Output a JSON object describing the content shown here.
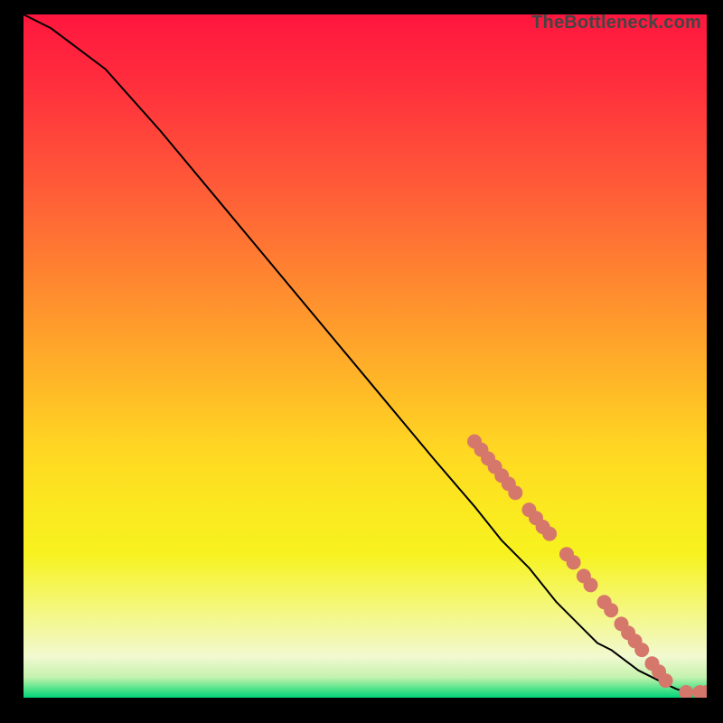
{
  "watermark": "TheBottleneck.com",
  "chart_data": {
    "type": "line",
    "title": "",
    "xlabel": "",
    "ylabel": "",
    "xlim": [
      0,
      100
    ],
    "ylim": [
      0,
      100
    ],
    "series": [
      {
        "name": "curve",
        "kind": "line",
        "color": "#000000",
        "x": [
          0,
          4,
          8,
          12,
          20,
          30,
          40,
          50,
          60,
          66,
          70,
          74,
          78,
          80,
          82,
          84,
          86,
          88,
          90,
          92,
          94,
          95.5,
          97,
          100
        ],
        "y": [
          100,
          98,
          95,
          92,
          83,
          71,
          59,
          47,
          35,
          28,
          23,
          19,
          14,
          12,
          10,
          8,
          7,
          5.5,
          4,
          3,
          2,
          1.3,
          0.8,
          0.8
        ]
      },
      {
        "name": "points",
        "kind": "scatter",
        "color": "#d6776c",
        "radius": 8,
        "points": [
          {
            "x": 66.0,
            "y": 37.5
          },
          {
            "x": 67.0,
            "y": 36.3
          },
          {
            "x": 68.0,
            "y": 35.0
          },
          {
            "x": 69.0,
            "y": 33.8
          },
          {
            "x": 70.0,
            "y": 32.5
          },
          {
            "x": 71.0,
            "y": 31.3
          },
          {
            "x": 72.0,
            "y": 30.0
          },
          {
            "x": 74.0,
            "y": 27.5
          },
          {
            "x": 75.0,
            "y": 26.3
          },
          {
            "x": 76.0,
            "y": 25.0
          },
          {
            "x": 77.0,
            "y": 24.0
          },
          {
            "x": 79.5,
            "y": 21.0
          },
          {
            "x": 80.5,
            "y": 19.8
          },
          {
            "x": 82.0,
            "y": 17.8
          },
          {
            "x": 83.0,
            "y": 16.5
          },
          {
            "x": 85.0,
            "y": 14.0
          },
          {
            "x": 86.0,
            "y": 12.8
          },
          {
            "x": 87.5,
            "y": 10.8
          },
          {
            "x": 88.5,
            "y": 9.5
          },
          {
            "x": 89.5,
            "y": 8.3
          },
          {
            "x": 90.5,
            "y": 7.0
          },
          {
            "x": 92.0,
            "y": 5.0
          },
          {
            "x": 93.0,
            "y": 3.8
          },
          {
            "x": 94.0,
            "y": 2.5
          },
          {
            "x": 97.0,
            "y": 0.8
          },
          {
            "x": 99.0,
            "y": 0.8
          },
          {
            "x": 100.0,
            "y": 0.8
          }
        ]
      }
    ]
  },
  "colors": {
    "point_fill": "#d6776c",
    "line": "#000000"
  }
}
